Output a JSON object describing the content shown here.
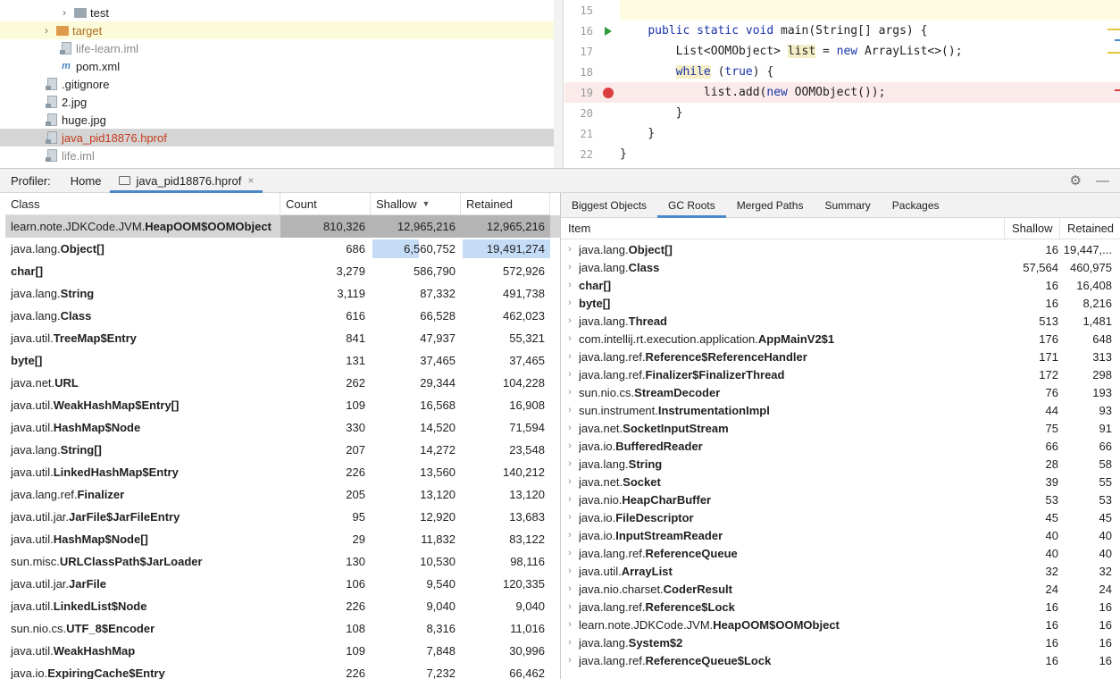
{
  "tree": {
    "items": [
      {
        "label": "test",
        "icon": "folder-icon",
        "color": "grey"
      },
      {
        "label": "target",
        "icon": "folder-icon",
        "color": "orange"
      },
      {
        "label": "life-learn.iml",
        "icon": "iml-file-icon"
      },
      {
        "label": "pom.xml",
        "icon": "maven-icon"
      },
      {
        "label": ".gitignore",
        "icon": "file-icon"
      },
      {
        "label": "2.jpg",
        "icon": "image-file-icon"
      },
      {
        "label": "huge.jpg",
        "icon": "image-file-icon"
      },
      {
        "label": "java_pid18876.hprof",
        "icon": "hprof-file-icon"
      },
      {
        "label": "life.iml",
        "icon": "iml-file-icon"
      }
    ]
  },
  "editor": {
    "lines": [
      {
        "num": "15",
        "code": ""
      },
      {
        "num": "16",
        "code": "    public static void main(String[] args) {"
      },
      {
        "num": "17",
        "code": "        List<OOMObject> list = new ArrayList<>();"
      },
      {
        "num": "18",
        "code": "        while (true) {"
      },
      {
        "num": "19",
        "code": "            list.add(new OOMObject());"
      },
      {
        "num": "20",
        "code": "        }"
      },
      {
        "num": "21",
        "code": "    }"
      },
      {
        "num": "22",
        "code": "}"
      }
    ]
  },
  "profiler": {
    "label": "Profiler:",
    "tabs": [
      {
        "label": "Home"
      },
      {
        "label": "java_pid18876.hprof"
      }
    ],
    "close_glyph": "×",
    "settings_icon": "⚙",
    "minimize_icon": "—"
  },
  "class_table": {
    "headers": {
      "class": "Class",
      "count": "Count",
      "shallow": "Shallow",
      "retained": "Retained"
    },
    "rows": [
      {
        "pkg": "learn.note.JDKCode.JVM.",
        "name": "HeapOOM$OOMObject",
        "count": "810,326",
        "shallow": "12,965,216",
        "retained": "12,965,216"
      },
      {
        "pkg": "java.lang.",
        "name": "Object[]",
        "count": "686",
        "shallow": "6,560,752",
        "retained": "19,491,274"
      },
      {
        "pkg": "",
        "name": "char[]",
        "count": "3,279",
        "shallow": "586,790",
        "retained": "572,926"
      },
      {
        "pkg": "java.lang.",
        "name": "String",
        "count": "3,119",
        "shallow": "87,332",
        "retained": "491,738"
      },
      {
        "pkg": "java.lang.",
        "name": "Class",
        "count": "616",
        "shallow": "66,528",
        "retained": "462,023"
      },
      {
        "pkg": "java.util.",
        "name": "TreeMap$Entry",
        "count": "841",
        "shallow": "47,937",
        "retained": "55,321"
      },
      {
        "pkg": "",
        "name": "byte[]",
        "count": "131",
        "shallow": "37,465",
        "retained": "37,465"
      },
      {
        "pkg": "java.net.",
        "name": "URL",
        "count": "262",
        "shallow": "29,344",
        "retained": "104,228"
      },
      {
        "pkg": "java.util.",
        "name": "WeakHashMap$Entry[]",
        "count": "109",
        "shallow": "16,568",
        "retained": "16,908"
      },
      {
        "pkg": "java.util.",
        "name": "HashMap$Node",
        "count": "330",
        "shallow": "14,520",
        "retained": "71,594"
      },
      {
        "pkg": "java.lang.",
        "name": "String[]",
        "count": "207",
        "shallow": "14,272",
        "retained": "23,548"
      },
      {
        "pkg": "java.util.",
        "name": "LinkedHashMap$Entry",
        "count": "226",
        "shallow": "13,560",
        "retained": "140,212"
      },
      {
        "pkg": "java.lang.ref.",
        "name": "Finalizer",
        "count": "205",
        "shallow": "13,120",
        "retained": "13,120"
      },
      {
        "pkg": "java.util.jar.",
        "name": "JarFile$JarFileEntry",
        "count": "95",
        "shallow": "12,920",
        "retained": "13,683"
      },
      {
        "pkg": "java.util.",
        "name": "HashMap$Node[]",
        "count": "29",
        "shallow": "11,832",
        "retained": "83,122"
      },
      {
        "pkg": "sun.misc.",
        "name": "URLClassPath$JarLoader",
        "count": "130",
        "shallow": "10,530",
        "retained": "98,116"
      },
      {
        "pkg": "java.util.jar.",
        "name": "JarFile",
        "count": "106",
        "shallow": "9,540",
        "retained": "120,335"
      },
      {
        "pkg": "java.util.",
        "name": "LinkedList$Node",
        "count": "226",
        "shallow": "9,040",
        "retained": "9,040"
      },
      {
        "pkg": "sun.nio.cs.",
        "name": "UTF_8$Encoder",
        "count": "108",
        "shallow": "8,316",
        "retained": "11,016"
      },
      {
        "pkg": "java.util.",
        "name": "WeakHashMap",
        "count": "109",
        "shallow": "7,848",
        "retained": "30,996"
      },
      {
        "pkg": "java.io.",
        "name": "ExpiringCache$Entry",
        "count": "226",
        "shallow": "7,232",
        "retained": "66,462"
      }
    ]
  },
  "right_tabs": [
    "Biggest Objects",
    "GC Roots",
    "Merged Paths",
    "Summary",
    "Packages"
  ],
  "gc_table": {
    "headers": {
      "item": "Item",
      "shallow": "Shallow",
      "retained": "Retained"
    },
    "rows": [
      {
        "pkg": "java.lang.",
        "name": "Object[]",
        "shallow": "16",
        "retained": "19,447,..."
      },
      {
        "pkg": "java.lang.",
        "name": "Class",
        "shallow": "57,564",
        "retained": "460,975"
      },
      {
        "pkg": "",
        "name": "char[]",
        "shallow": "16",
        "retained": "16,408"
      },
      {
        "pkg": "",
        "name": "byte[]",
        "shallow": "16",
        "retained": "8,216"
      },
      {
        "pkg": "java.lang.",
        "name": "Thread",
        "shallow": "513",
        "retained": "1,481"
      },
      {
        "pkg": "com.intellij.rt.execution.application.",
        "name": "AppMainV2$1",
        "shallow": "176",
        "retained": "648"
      },
      {
        "pkg": "java.lang.ref.",
        "name": "Reference$ReferenceHandler",
        "shallow": "171",
        "retained": "313"
      },
      {
        "pkg": "java.lang.ref.",
        "name": "Finalizer$FinalizerThread",
        "shallow": "172",
        "retained": "298"
      },
      {
        "pkg": "sun.nio.cs.",
        "name": "StreamDecoder",
        "shallow": "76",
        "retained": "193"
      },
      {
        "pkg": "sun.instrument.",
        "name": "InstrumentationImpl",
        "shallow": "44",
        "retained": "93"
      },
      {
        "pkg": "java.net.",
        "name": "SocketInputStream",
        "shallow": "75",
        "retained": "91"
      },
      {
        "pkg": "java.io.",
        "name": "BufferedReader",
        "shallow": "66",
        "retained": "66"
      },
      {
        "pkg": "java.lang.",
        "name": "String",
        "shallow": "28",
        "retained": "58"
      },
      {
        "pkg": "java.net.",
        "name": "Socket",
        "shallow": "39",
        "retained": "55"
      },
      {
        "pkg": "java.nio.",
        "name": "HeapCharBuffer",
        "shallow": "53",
        "retained": "53"
      },
      {
        "pkg": "java.io.",
        "name": "FileDescriptor",
        "shallow": "45",
        "retained": "45"
      },
      {
        "pkg": "java.io.",
        "name": "InputStreamReader",
        "shallow": "40",
        "retained": "40"
      },
      {
        "pkg": "java.lang.ref.",
        "name": "ReferenceQueue",
        "shallow": "40",
        "retained": "40"
      },
      {
        "pkg": "java.util.",
        "name": "ArrayList",
        "shallow": "32",
        "retained": "32"
      },
      {
        "pkg": "java.nio.charset.",
        "name": "CoderResult",
        "shallow": "24",
        "retained": "24"
      },
      {
        "pkg": "java.lang.ref.",
        "name": "Reference$Lock",
        "shallow": "16",
        "retained": "16"
      },
      {
        "pkg": "learn.note.JDKCode.JVM.",
        "name": "HeapOOM$OOMObject",
        "shallow": "16",
        "retained": "16"
      },
      {
        "pkg": "java.lang.",
        "name": "System$2",
        "shallow": "16",
        "retained": "16"
      },
      {
        "pkg": "java.lang.ref.",
        "name": "ReferenceQueue$Lock",
        "shallow": "16",
        "retained": "16"
      }
    ]
  },
  "colors": {
    "accent": "#4a88c7",
    "keyword": "#1a34a8",
    "breakpoint": "#db3e3e",
    "bar": "#c5dcf7"
  }
}
